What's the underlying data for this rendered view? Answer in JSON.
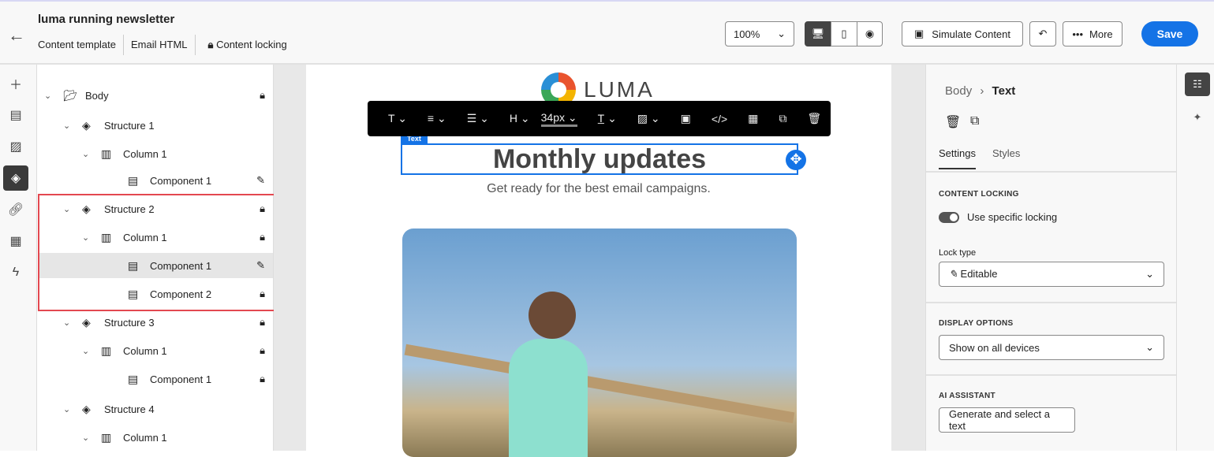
{
  "header": {
    "title": "luma running newsletter",
    "tabs": [
      "Content template",
      "Email HTML"
    ],
    "content_locking": "Content locking",
    "zoom": "100%",
    "simulate": "Simulate Content",
    "more": "More",
    "save": "Save"
  },
  "tree": [
    {
      "label": "Body",
      "level": 0,
      "icon": "folder-icon",
      "right": "lock-icon"
    },
    {
      "label": "Structure 1",
      "level": 1,
      "icon": "layers-icon",
      "right": ""
    },
    {
      "label": "Column 1",
      "level": 2,
      "icon": "columns-icon",
      "right": ""
    },
    {
      "label": "Component 1",
      "level": 3,
      "icon": "component-icon",
      "right": "pencil-icon"
    },
    {
      "label": "Structure 2",
      "level": 1,
      "icon": "layers-icon",
      "right": "lock-icon"
    },
    {
      "label": "Column 1",
      "level": 2,
      "icon": "columns-icon",
      "right": "lock-icon"
    },
    {
      "label": "Component 1",
      "level": 3,
      "icon": "component-icon",
      "right": "pencil-icon",
      "selected": true
    },
    {
      "label": "Component 2",
      "level": 3,
      "icon": "component-icon",
      "right": "lock-icon"
    },
    {
      "label": "Structure 3",
      "level": 1,
      "icon": "layers-icon",
      "right": "lock-icon"
    },
    {
      "label": "Column 1",
      "level": 2,
      "icon": "columns-icon",
      "right": "lock-icon"
    },
    {
      "label": "Component 1",
      "level": 3,
      "icon": "component-icon",
      "right": "lock-icon"
    },
    {
      "label": "Structure 4",
      "level": 1,
      "icon": "layers-icon",
      "right": ""
    },
    {
      "label": "Column 1",
      "level": 2,
      "icon": "columns-icon",
      "right": ""
    }
  ],
  "toolbar": {
    "font_size": "34px",
    "heading": "H",
    "badge": "Text"
  },
  "email": {
    "logo": "LUMA",
    "heading": "Monthly updates",
    "subheading": "Get ready for the best email campaigns."
  },
  "panel": {
    "breadcrumb_root": "Body",
    "breadcrumb_current": "Text",
    "tabs": [
      "Settings",
      "Styles"
    ],
    "content_locking_label": "CONTENT LOCKING",
    "toggle_label": "Use specific locking",
    "lock_type_label": "Lock type",
    "lock_type_value": "Editable",
    "display_label": "DISPLAY OPTIONS",
    "display_value": "Show on all devices",
    "ai_label": "AI ASSISTANT",
    "ai_button": "Generate and select a text"
  }
}
